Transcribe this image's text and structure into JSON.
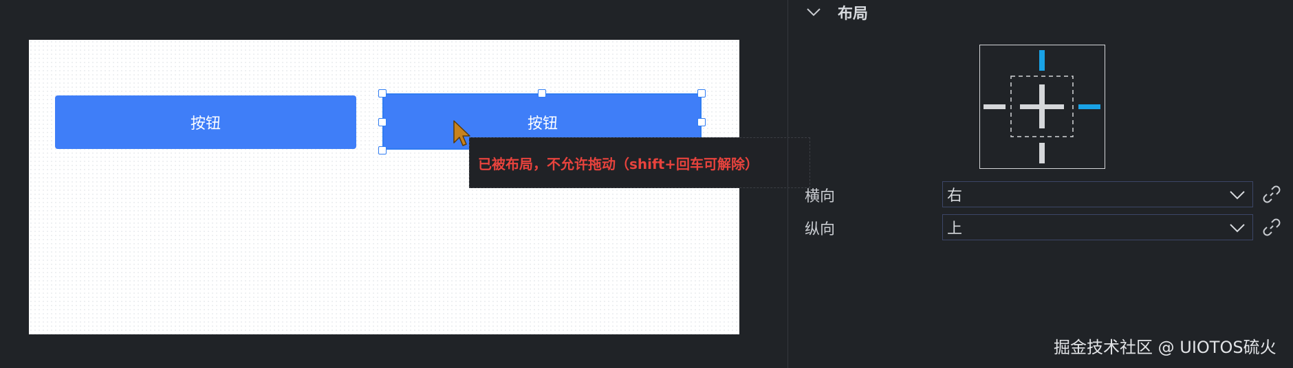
{
  "canvas": {
    "button_left_label": "按钮",
    "button_right_label": "按钮",
    "tooltip": "已被布局，不允许拖动（shift+回车可解除）"
  },
  "panel": {
    "section_title": "布局",
    "horizontal_label": "横向",
    "horizontal_value": "右",
    "vertical_label": "纵向",
    "vertical_value": "上"
  },
  "watermark": "掘金技术社区 @ UIOTOS硫火",
  "colors": {
    "accent": "#3f7ef8",
    "warning_text": "#e8433d",
    "anchor_active": "#19a2e6",
    "anchor_inactive": "#d5d7da",
    "panel_bg": "#202327"
  },
  "icons": {
    "section": "chevron-down-icon",
    "select": "chevron-down-icon",
    "link": "link-icon",
    "cursor": "cursor-arrow-icon"
  }
}
